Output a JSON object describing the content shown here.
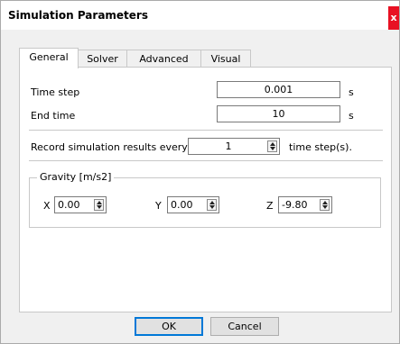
{
  "window": {
    "title": "Simulation Parameters",
    "close_glyph": "x"
  },
  "tabs": [
    {
      "label": "General",
      "active": true
    },
    {
      "label": "Solver",
      "active": false
    },
    {
      "label": "Advanced",
      "active": false
    },
    {
      "label": "Visual",
      "active": false
    }
  ],
  "general": {
    "time_step": {
      "label": "Time step",
      "value": "0.001",
      "unit": "s"
    },
    "end_time": {
      "label": "End time",
      "value": "10",
      "unit": "s"
    },
    "record": {
      "label": "Record simulation results every",
      "value": "1",
      "unit": "time step(s)."
    },
    "gravity": {
      "title": "Gravity [m/s2]",
      "x": {
        "label": "X",
        "value": "0.00"
      },
      "y": {
        "label": "Y",
        "value": "0.00"
      },
      "z": {
        "label": "Z",
        "value": "-9.80"
      }
    }
  },
  "buttons": {
    "ok": "OK",
    "cancel": "Cancel"
  }
}
